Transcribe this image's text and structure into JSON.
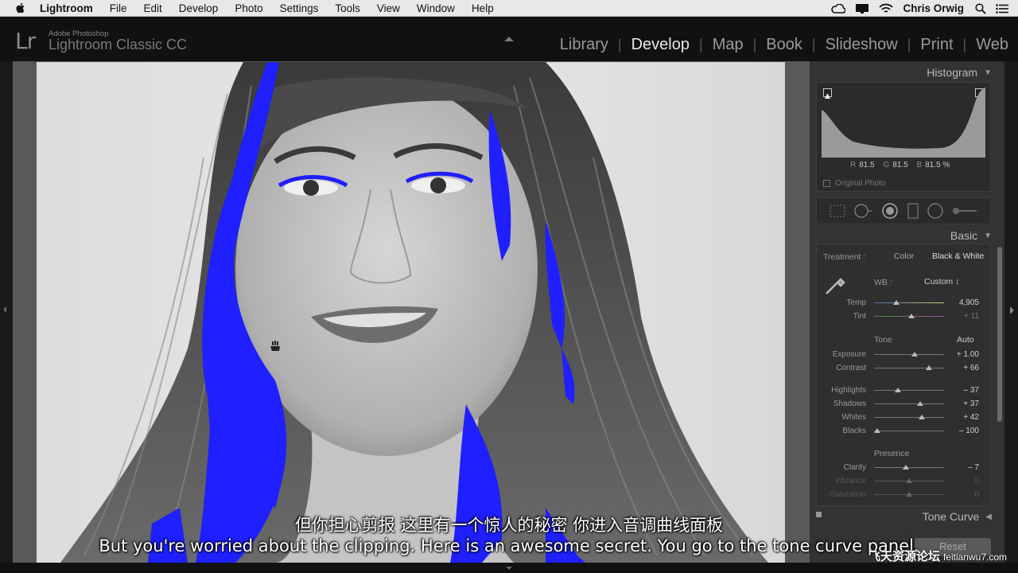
{
  "menubar": {
    "app_name": "Lightroom",
    "items": [
      "File",
      "Edit",
      "Develop",
      "Photo",
      "Settings",
      "Tools",
      "View",
      "Window",
      "Help"
    ],
    "user": "Chris Orwig"
  },
  "header": {
    "logo": "Lr",
    "brand_small": "Adobe Photoshop",
    "brand_big": "Lightroom Classic CC",
    "modules": [
      "Library",
      "Develop",
      "Map",
      "Book",
      "Slideshow",
      "Print",
      "Web"
    ],
    "active_module": "Develop"
  },
  "histogram": {
    "title": "Histogram",
    "r_label": "R",
    "r_value": "81.5",
    "g_label": "G",
    "g_value": "81.5",
    "b_label": "B",
    "b_value": "81.5 %",
    "original_photo": "Original Photo"
  },
  "basic": {
    "title": "Basic",
    "treatment_label": "Treatment :",
    "treatment_color": "Color",
    "treatment_bw": "Black & White",
    "wb_label": "WB :",
    "wb_value": "Custom ↕",
    "temp_label": "Temp",
    "temp_value": "4,905",
    "tint_label": "Tint",
    "tint_value": "+ 11",
    "tone_label": "Tone",
    "auto_label": "Auto",
    "exposure_label": "Exposure",
    "exposure_value": "+ 1.00",
    "contrast_label": "Contrast",
    "contrast_value": "+ 66",
    "highlights_label": "Highlights",
    "highlights_value": "– 37",
    "shadows_label": "Shadows",
    "shadows_value": "+ 37",
    "whites_label": "Whites",
    "whites_value": "+ 42",
    "blacks_label": "Blacks",
    "blacks_value": "– 100",
    "presence_label": "Presence",
    "clarity_label": "Clarity",
    "clarity_value": "– 7",
    "vibrance_label": "Vibrance",
    "vibrance_value": "0",
    "saturation_label": "Saturation",
    "saturation_value": "0"
  },
  "tone_curve": {
    "title": "Tone Curve"
  },
  "reset_button": "Reset",
  "subtitles": {
    "chinese": "但你担心剪报 这里有一个惊人的秘密 你进入音调曲线面板",
    "english": "But you're worried about the clipping. Here is an awesome secret. You go to the tone curve panel."
  },
  "watermark": {
    "text_big": "飞天资源论坛",
    "text_small": "feitianwu7.com"
  },
  "colors": {
    "clipping_overlay": "#1f1fff",
    "active_module": "#e8e8e8",
    "panel_bg": "#333333"
  }
}
